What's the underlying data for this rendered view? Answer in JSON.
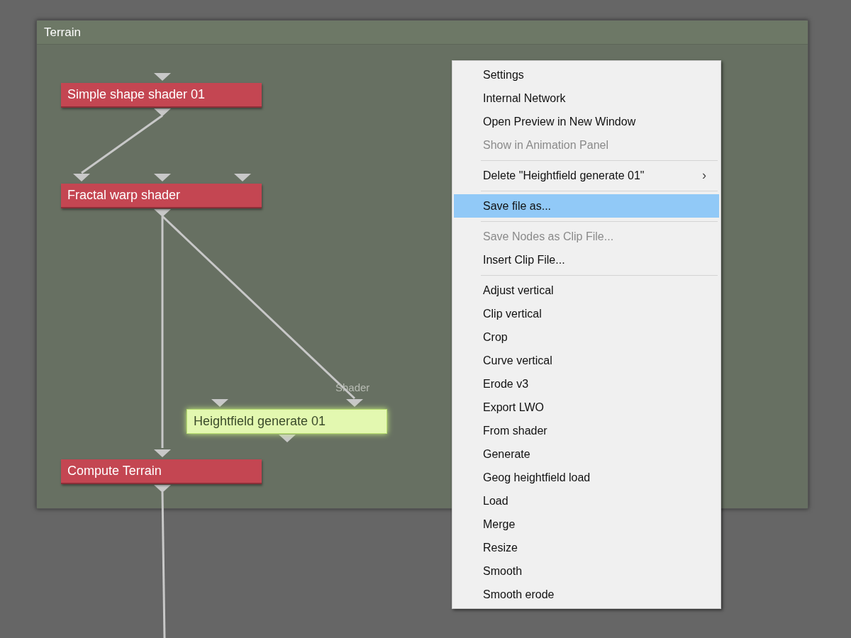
{
  "panel": {
    "title": "Terrain"
  },
  "nodes": [
    {
      "label": "Simple shape shader 01",
      "selected": false
    },
    {
      "label": "Fractal warp shader",
      "selected": false
    },
    {
      "label": "Heightfield generate 01",
      "selected": true
    },
    {
      "label": "Compute Terrain",
      "selected": false
    }
  ],
  "port_label": "Shader",
  "context_menu": [
    {
      "kind": "item",
      "label": "Settings",
      "disabled": false,
      "selected": false
    },
    {
      "kind": "item",
      "label": "Internal Network",
      "disabled": false,
      "selected": false
    },
    {
      "kind": "item",
      "label": "Open Preview in New Window",
      "disabled": false,
      "selected": false
    },
    {
      "kind": "item",
      "label": "Show in Animation Panel",
      "disabled": true,
      "selected": false
    },
    {
      "kind": "separator"
    },
    {
      "kind": "submenu",
      "label": "Delete \"Heightfield generate 01\"",
      "arrow": "›",
      "disabled": false,
      "selected": false
    },
    {
      "kind": "separator"
    },
    {
      "kind": "item",
      "label": "Save file as...",
      "disabled": false,
      "selected": true
    },
    {
      "kind": "separator"
    },
    {
      "kind": "item",
      "label": "Save Nodes as Clip File...",
      "disabled": true,
      "selected": false
    },
    {
      "kind": "item",
      "label": "Insert Clip File...",
      "disabled": false,
      "selected": false
    },
    {
      "kind": "separator"
    },
    {
      "kind": "item",
      "label": "Adjust vertical",
      "disabled": false,
      "selected": false
    },
    {
      "kind": "item",
      "label": "Clip vertical",
      "disabled": false,
      "selected": false
    },
    {
      "kind": "item",
      "label": "Crop",
      "disabled": false,
      "selected": false
    },
    {
      "kind": "item",
      "label": "Curve vertical",
      "disabled": false,
      "selected": false
    },
    {
      "kind": "item",
      "label": "Erode v3",
      "disabled": false,
      "selected": false
    },
    {
      "kind": "item",
      "label": "Export LWO",
      "disabled": false,
      "selected": false
    },
    {
      "kind": "item",
      "label": "From shader",
      "disabled": false,
      "selected": false
    },
    {
      "kind": "item",
      "label": "Generate",
      "disabled": false,
      "selected": false
    },
    {
      "kind": "item",
      "label": "Geog heightfield load",
      "disabled": false,
      "selected": false
    },
    {
      "kind": "item",
      "label": "Load",
      "disabled": false,
      "selected": false
    },
    {
      "kind": "item",
      "label": "Merge",
      "disabled": false,
      "selected": false
    },
    {
      "kind": "item",
      "label": "Resize",
      "disabled": false,
      "selected": false
    },
    {
      "kind": "item",
      "label": "Smooth",
      "disabled": false,
      "selected": false
    },
    {
      "kind": "item",
      "label": "Smooth erode",
      "disabled": false,
      "selected": false
    }
  ]
}
